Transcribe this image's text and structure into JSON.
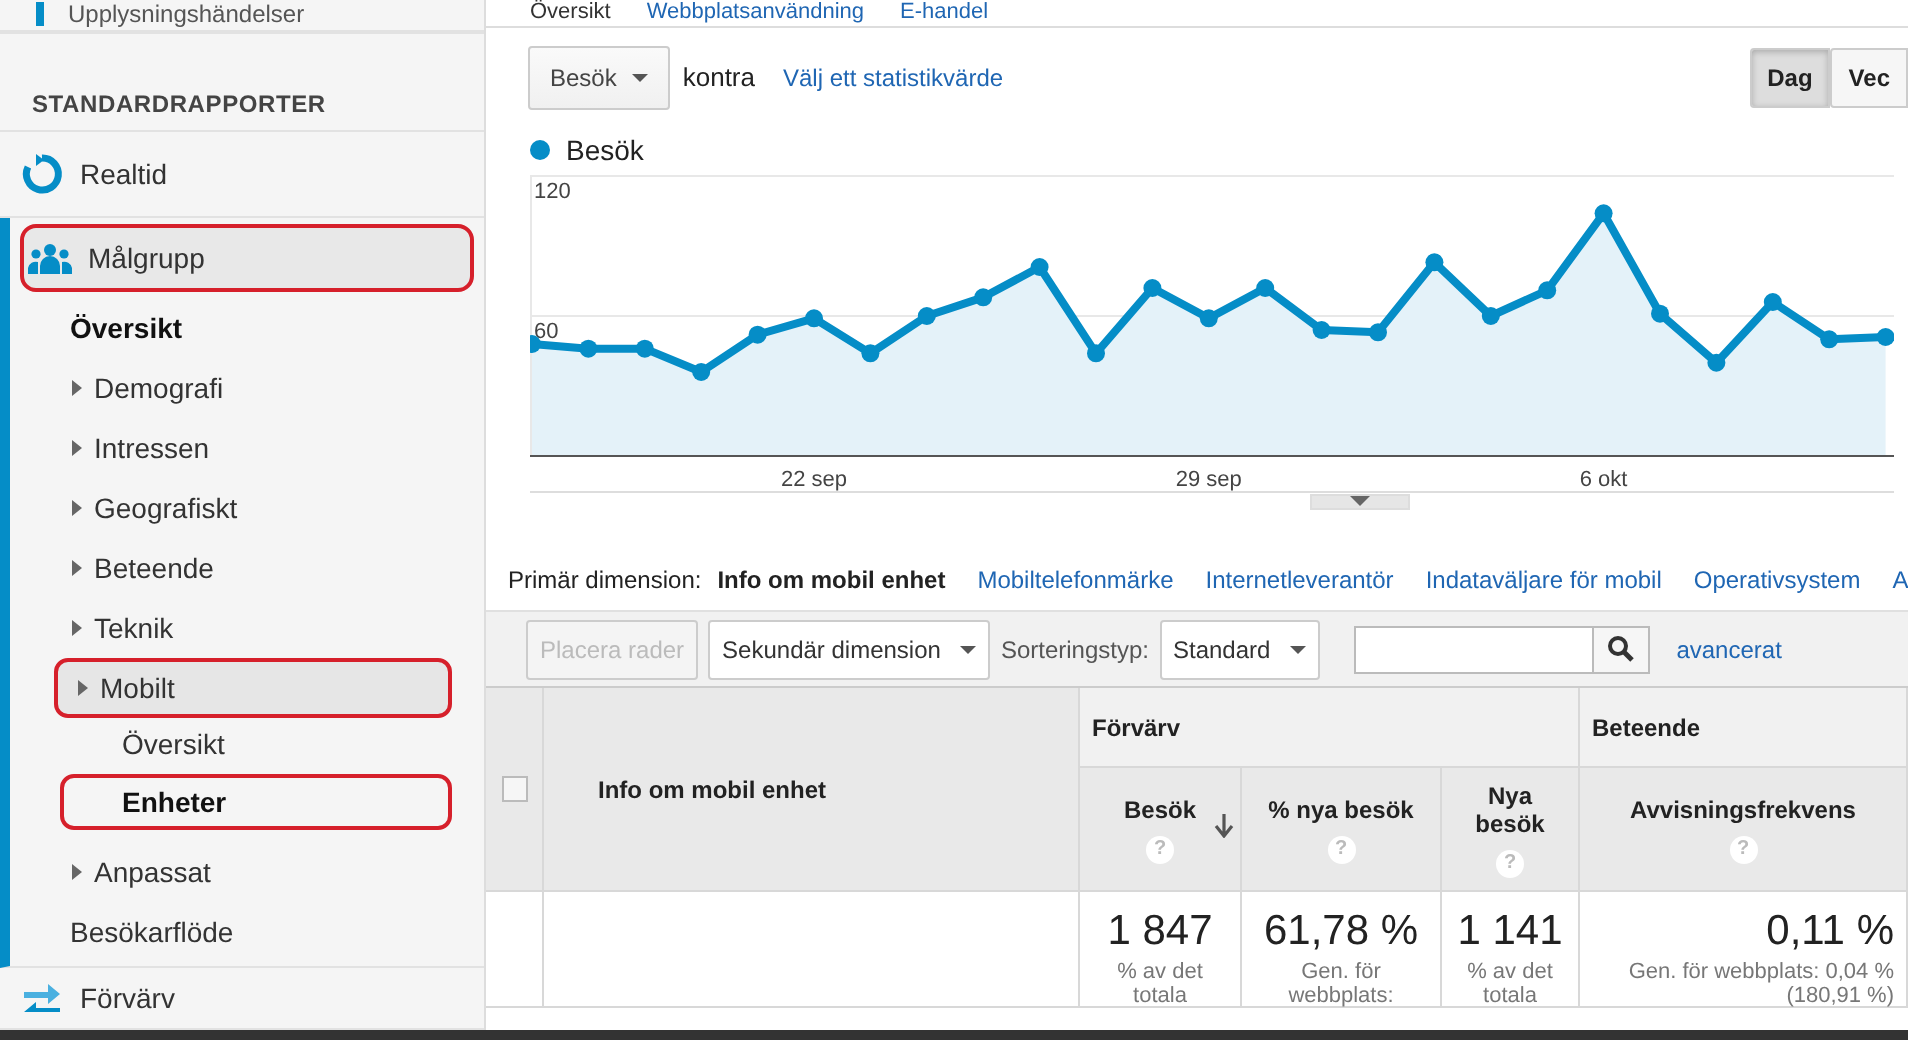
{
  "sidebar": {
    "top_item": {
      "label": "Upplysningshändelser"
    },
    "section_title": "STANDARDRAPPORTER",
    "items": [
      {
        "label": "Realtid",
        "expanded": false,
        "annotated": false
      },
      {
        "label": "Målgrupp",
        "expanded": true,
        "annotated": true,
        "children": [
          {
            "label": "Översikt",
            "selected": true,
            "annotated": false,
            "has_caret": false
          },
          {
            "label": "Demografi",
            "selected": false,
            "annotated": false,
            "has_caret": true
          },
          {
            "label": "Intressen",
            "selected": false,
            "annotated": false,
            "has_caret": true
          },
          {
            "label": "Geografiskt",
            "selected": false,
            "annotated": false,
            "has_caret": true
          },
          {
            "label": "Beteende",
            "selected": false,
            "annotated": false,
            "has_caret": true
          },
          {
            "label": "Teknik",
            "selected": false,
            "annotated": false,
            "has_caret": true
          },
          {
            "label": "Mobilt",
            "selected": false,
            "annotated": true,
            "has_caret": true,
            "children": [
              {
                "label": "Översikt",
                "selected": false,
                "annotated": false
              },
              {
                "label": "Enheter",
                "selected": true,
                "annotated": true
              }
            ]
          },
          {
            "label": "Anpassat",
            "selected": false,
            "annotated": false,
            "has_caret": true
          },
          {
            "label": "Besökarflöde",
            "selected": false,
            "annotated": false,
            "has_caret": false
          }
        ]
      },
      {
        "label": "Förvärv",
        "expanded": false,
        "annotated": false
      }
    ]
  },
  "top_tabs": [
    {
      "label": "Översikt",
      "selected": true
    },
    {
      "label": "Webbplatsanvändning",
      "selected": false
    },
    {
      "label": "E-handel",
      "selected": false
    }
  ],
  "metric_bar": {
    "metric": "Besök",
    "versus": "kontra",
    "link": "Välj ett statistikvärde",
    "periods": [
      {
        "label": "Dag",
        "selected": true
      },
      {
        "label": "Vec",
        "selected": false
      }
    ]
  },
  "chart": {
    "x_axis_labels": [
      "22 sep",
      "29 sep",
      "6 okt"
    ],
    "chart_data": {
      "type": "area",
      "series": [
        {
          "name": "Besök",
          "color": "#058dc7",
          "values": [
            48,
            46,
            46,
            36,
            52,
            59,
            44,
            60,
            68,
            81,
            44,
            72,
            59,
            72,
            54,
            53,
            83,
            60,
            71,
            104,
            61,
            40,
            66,
            50,
            51
          ]
        }
      ],
      "yticks": [
        {
          "value": 60,
          "label": "60"
        },
        {
          "value": 120,
          "label": "120"
        }
      ],
      "ylim": [
        0,
        120
      ]
    }
  },
  "dimensions": {
    "label": "Primär dimension:",
    "items": [
      {
        "label": "Info om mobil enhet",
        "selected": true
      },
      {
        "label": "Mobiltelefonmärke",
        "selected": false
      },
      {
        "label": "Internetleverantör",
        "selected": false
      },
      {
        "label": "Indataväljare för mobil",
        "selected": false
      },
      {
        "label": "Operativsystem",
        "selected": false
      },
      {
        "label": "A",
        "selected": false
      }
    ]
  },
  "toolbar": {
    "plot_rows": {
      "label": "Placera rader",
      "disabled": true
    },
    "secondary": "Sekundär dimension",
    "sort_label": "Sorteringstyp:",
    "sort_value": "Standard",
    "advanced": "avancerat"
  },
  "table": {
    "checkbox_checked": false,
    "dimension_header": "Info om mobil enhet",
    "groups": [
      {
        "label": "Förvärv"
      },
      {
        "label": "Beteende"
      }
    ],
    "columns": [
      {
        "label": "Besök",
        "help": "?",
        "sorted": true
      },
      {
        "label": "% nya besök",
        "help": "?",
        "sorted": false
      },
      {
        "label": "Nya besök",
        "help": "?",
        "sorted": false
      },
      {
        "label": "Avvisningsfrekvens",
        "help": "?",
        "sorted": false
      }
    ],
    "totals": [
      {
        "value": "1 847",
        "note": "% av det totala"
      },
      {
        "value": "61,78 %",
        "note": "Gen. för webbplats:"
      },
      {
        "value": "1 141",
        "note": "% av det totala"
      },
      {
        "value": "0,11 %",
        "note": "Gen. för webbplats: 0,04 % (180,91 %)"
      }
    ]
  }
}
